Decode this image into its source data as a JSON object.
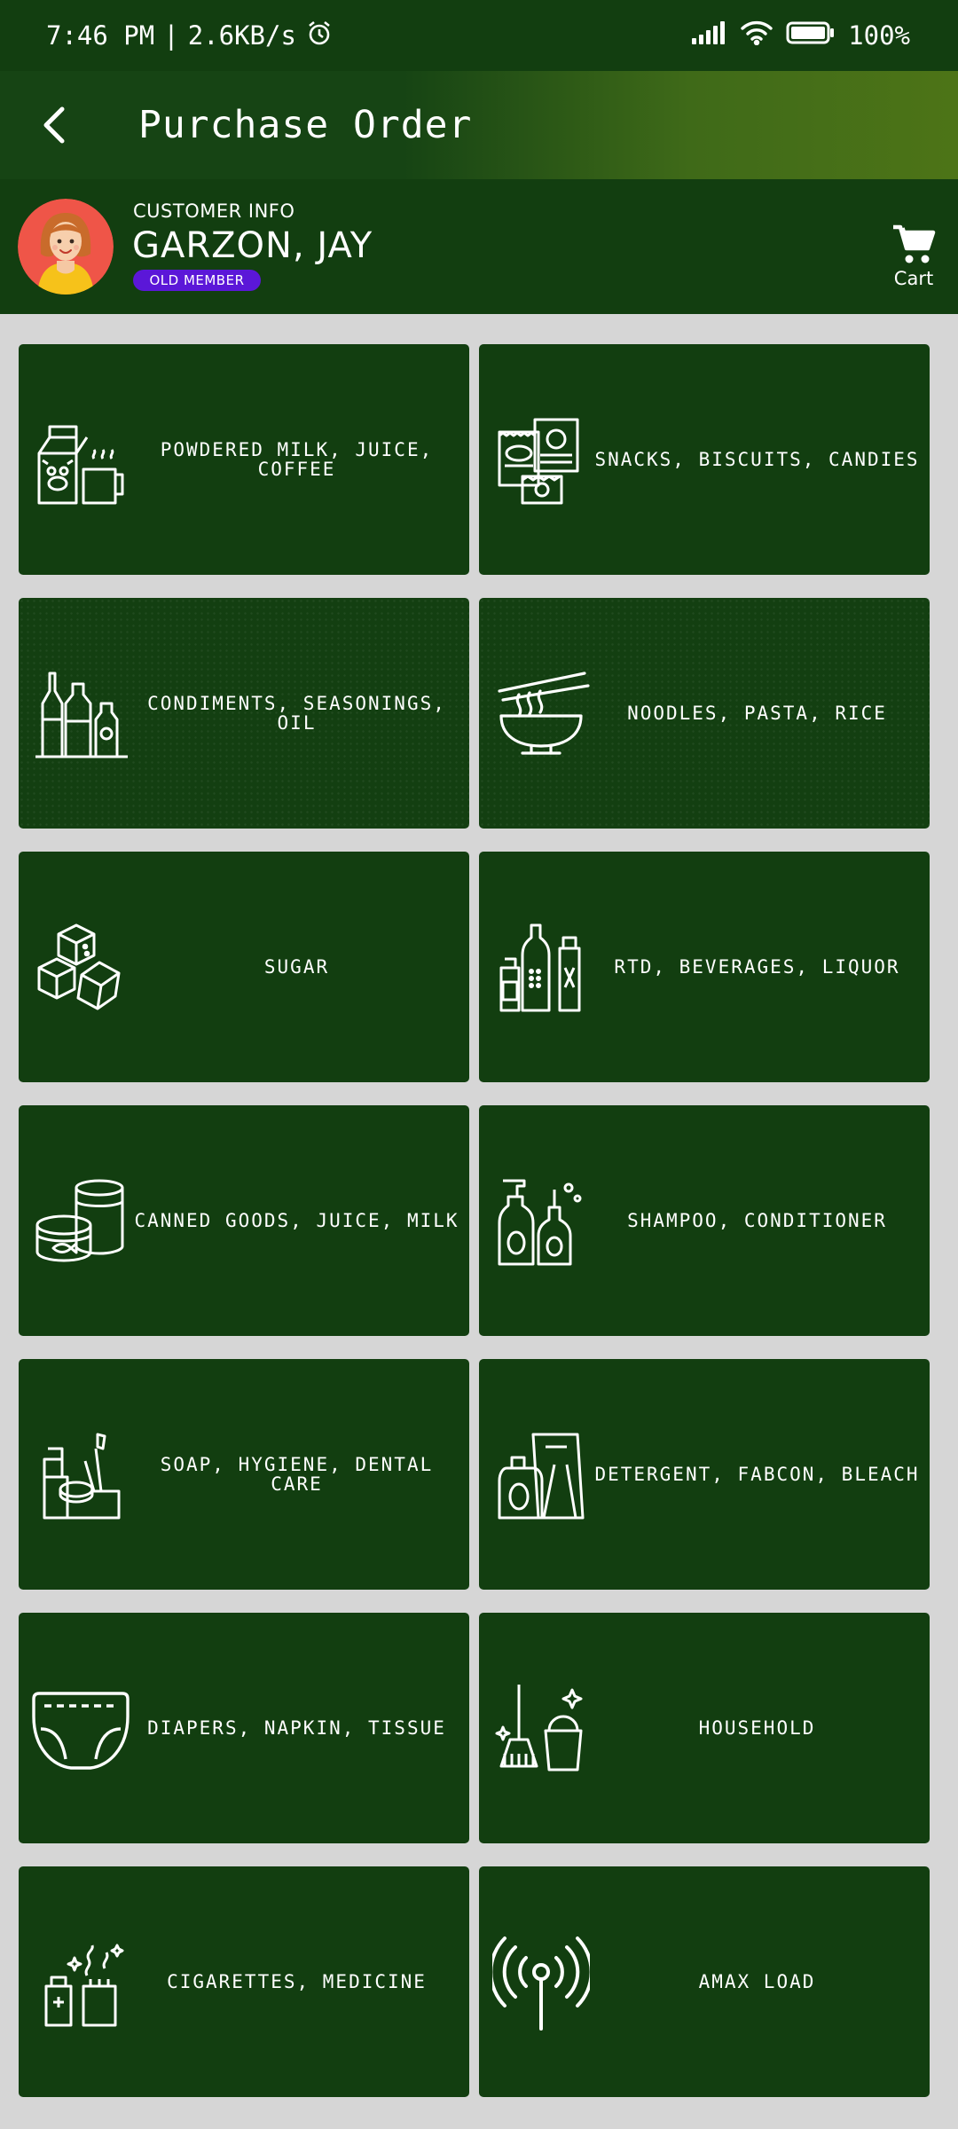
{
  "status_bar": {
    "time": "7:46 PM",
    "separator": "|",
    "speed": "2.6KB/s",
    "battery": "100%",
    "icons": [
      "alarm-icon",
      "signal-icon",
      "wifi-icon",
      "battery-icon"
    ]
  },
  "app_bar": {
    "title": "Purchase Order",
    "back_icon": "chevron-left-icon"
  },
  "customer": {
    "label": "CUSTOMER INFO",
    "name": "GARZON, JAY",
    "badge": "OLD MEMBER",
    "cart_label": "Cart",
    "cart_icon": "cart-icon"
  },
  "categories": [
    {
      "label": "POWDERED MILK, JUICE, COFFEE",
      "icon": "milk-carton-icon"
    },
    {
      "label": "SNACKS, BISCUITS, CANDIES",
      "icon": "snacks-icon"
    },
    {
      "label": "CONDIMENTS, SEASONINGS, OIL",
      "icon": "condiment-bottles-icon"
    },
    {
      "label": "NOODLES, PASTA, RICE",
      "icon": "noodle-bowl-icon"
    },
    {
      "label": "SUGAR",
      "icon": "sugar-cubes-icon"
    },
    {
      "label": "RTD, BEVERAGES, LIQUOR",
      "icon": "beverage-bottles-icon"
    },
    {
      "label": "CANNED GOODS, JUICE, MILK",
      "icon": "canned-goods-icon"
    },
    {
      "label": "SHAMPOO, CONDITIONER",
      "icon": "shampoo-bottles-icon"
    },
    {
      "label": "SOAP, HYGIENE, DENTAL CARE",
      "icon": "hygiene-icon"
    },
    {
      "label": "DETERGENT, FABCON, BLEACH",
      "icon": "detergent-icon"
    },
    {
      "label": "DIAPERS, NAPKIN, TISSUE",
      "icon": "diaper-icon"
    },
    {
      "label": "HOUSEHOLD",
      "icon": "broom-bucket-icon"
    },
    {
      "label": "CIGARETTES, MEDICINE",
      "icon": "medicine-icon"
    },
    {
      "label": "AMAX LOAD",
      "icon": "antenna-icon"
    }
  ],
  "colors": {
    "primary_dark": "#123e10",
    "app_bar_gradient_end": "#4d7417",
    "badge": "#5b17d8",
    "background": "#d6d6d6"
  }
}
